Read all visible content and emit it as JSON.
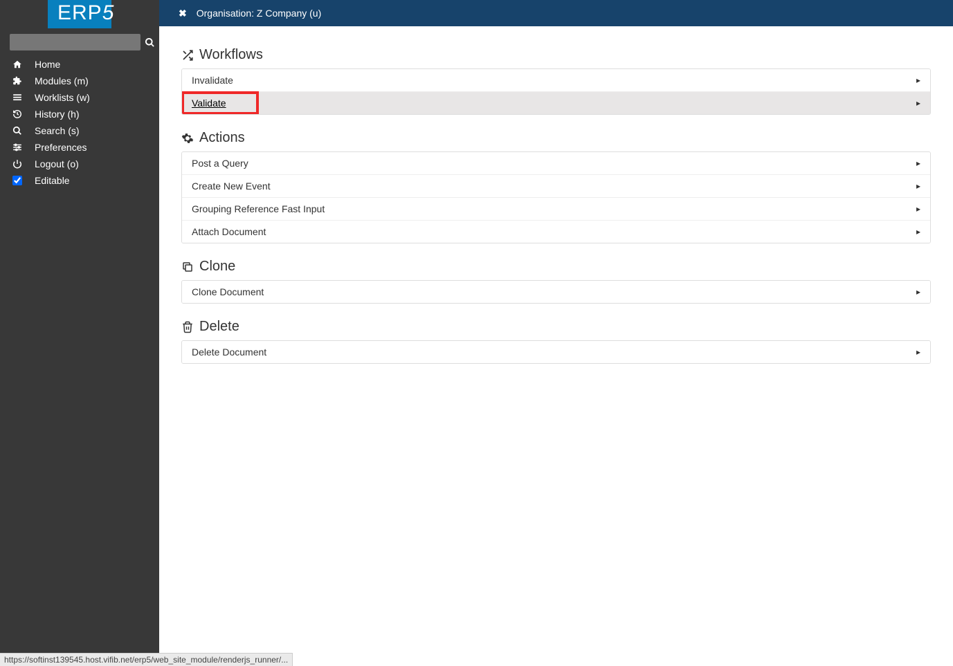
{
  "logo": {
    "text_main": "ERP",
    "text_suffix": "5"
  },
  "sidebar": {
    "nav": [
      {
        "icon": "home",
        "label": "Home"
      },
      {
        "icon": "puzzle",
        "label": "Modules (m)"
      },
      {
        "icon": "list",
        "label": "Worklists (w)"
      },
      {
        "icon": "history",
        "label": "History (h)"
      },
      {
        "icon": "search",
        "label": "Search (s)"
      },
      {
        "icon": "sliders",
        "label": "Preferences"
      },
      {
        "icon": "power",
        "label": "Logout (o)"
      }
    ],
    "editable_label": "Editable",
    "editable_checked": true
  },
  "topbar": {
    "breadcrumb": "Organisation: Z Company (u)"
  },
  "sections": {
    "workflows": {
      "title": "Workflows",
      "items": [
        {
          "label": "Invalidate",
          "highlighted": false
        },
        {
          "label": "Validate",
          "highlighted": true
        }
      ]
    },
    "actions": {
      "title": "Actions",
      "items": [
        {
          "label": "Post a Query"
        },
        {
          "label": "Create New Event"
        },
        {
          "label": "Grouping Reference Fast Input"
        },
        {
          "label": "Attach Document"
        }
      ]
    },
    "clone": {
      "title": "Clone",
      "items": [
        {
          "label": "Clone Document"
        }
      ]
    },
    "delete": {
      "title": "Delete",
      "items": [
        {
          "label": "Delete Document"
        }
      ]
    }
  },
  "status_url": "https://softinst139545.host.vifib.net/erp5/web_site_module/renderjs_runner/..."
}
